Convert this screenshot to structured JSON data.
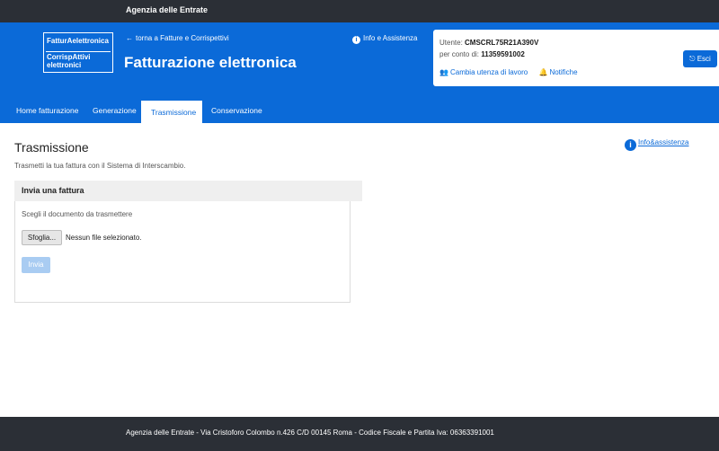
{
  "agency": {
    "name": "Agenzia delle Entrate"
  },
  "header": {
    "logo": {
      "line1": "FatturAelettronica",
      "line2": "CorrispAttivi elettronici"
    },
    "back_link": "torna a Fatture e Corrispettivi",
    "info_link": "Info e Assistenza",
    "title": "Fatturazione elettronica"
  },
  "user": {
    "user_label": "Utente:",
    "user_value": "CMSCRL75R21A390V",
    "account_label": "per conto di:",
    "account_value": "11359591002",
    "change_utenza": "Cambia utenza di lavoro",
    "notifiche": "Notifiche",
    "logout": "Esci"
  },
  "tabs": [
    {
      "label": "Home fatturazione",
      "active": false
    },
    {
      "label": "Generazione",
      "active": false
    },
    {
      "label": "Trasmissione",
      "active": true
    },
    {
      "label": "Conservazione",
      "active": false
    }
  ],
  "main": {
    "title": "Trasmissione",
    "subtitle": "Trasmetti la tua fattura con il Sistema di Interscambio.",
    "help_link": "Info&assistenza",
    "panel": {
      "heading": "Invia una fattura",
      "doc_label": "Scegli il documento da trasmettere",
      "file_button": "Sfoglia...",
      "file_status": "Nessun file selezionato.",
      "send_button": "Invia"
    }
  },
  "footer": {
    "text": "Agenzia delle Entrate - Via Cristoforo Colombo n.426 C/D 00145 Roma - Codice Fiscale e Partita Iva: 06363391001"
  },
  "colors": {
    "primary": "#0b6ad8",
    "dark_bar": "#2b2f36",
    "disabled_button": "#a9ccf2"
  }
}
